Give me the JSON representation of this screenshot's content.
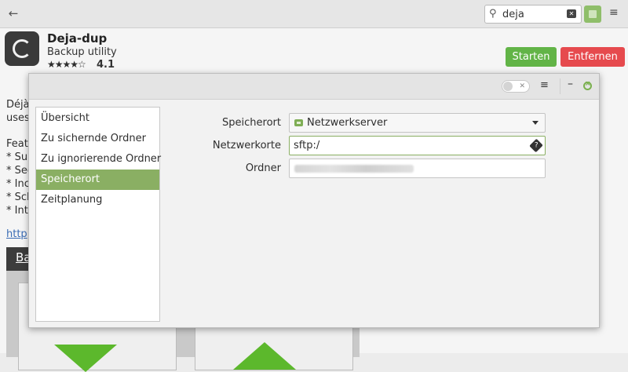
{
  "topbar": {
    "back_icon": "arrow-left-icon",
    "search_value": "deja",
    "search_icon": "search-icon",
    "clear_icon": "backspace-icon",
    "menu_icon": "hamburger-icon"
  },
  "app": {
    "name": "Deja-dup",
    "subtitle": "Backup utility",
    "stars": "★★★★☆",
    "rating": "4.1",
    "start_label": "Starten",
    "remove_label": "Entfernen"
  },
  "background": {
    "lines": [
      "Déjà",
      "uses",
      "",
      "Feat",
      "* Sup",
      "* Sec",
      "* Inc",
      "* Sch",
      "* Int"
    ],
    "link": "http",
    "screenshot_title": "Ba"
  },
  "dialog": {
    "sidebar": [
      {
        "label": "Übersicht"
      },
      {
        "label": "Zu sichernde Ordner"
      },
      {
        "label": "Zu ignorierende Ordner"
      },
      {
        "label": "Speicherort"
      },
      {
        "label": "Zeitplanung"
      }
    ],
    "active_index": 3,
    "form": {
      "location_label": "Speicherort",
      "location_value": "Netzwerkserver",
      "address_label": "Netzwerkorte",
      "address_value": "sftp:/",
      "folder_label": "Ordner"
    }
  },
  "colors": {
    "accent_green": "#8aaf63",
    "start_green": "#62b447",
    "remove_red": "#e64a4e"
  }
}
